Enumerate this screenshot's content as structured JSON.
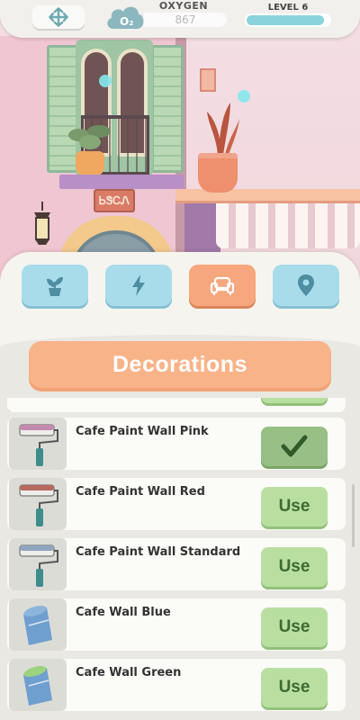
{
  "hud": {
    "oxygen_label": "OXYGEN",
    "oxygen_value": "867",
    "level_label": "LEVEL 6",
    "level_progress": 0.93,
    "o2_badge": "O₂",
    "move_icon": "move-arrows-icon"
  },
  "scene": {
    "sign_text": "ᏏᏕᏟᏁ"
  },
  "tabs": [
    {
      "name": "plants",
      "icon": "potted-plant-icon",
      "active": false
    },
    {
      "name": "energy",
      "icon": "lightning-icon",
      "active": false
    },
    {
      "name": "decorations",
      "icon": "armchair-icon",
      "active": true
    },
    {
      "name": "locations",
      "icon": "map-pin-icon",
      "active": false
    }
  ],
  "panel": {
    "title": "Decorations"
  },
  "items": [
    {
      "name": "Cafe Paint Wall Pink",
      "icon": "paint-roller-pink-icon",
      "button": "✔",
      "selected": true
    },
    {
      "name": "Cafe Paint Wall Red",
      "icon": "paint-roller-red-icon",
      "button": "Use",
      "selected": false
    },
    {
      "name": "Cafe Paint Wall Standard",
      "icon": "paint-roller-standard-icon",
      "button": "Use",
      "selected": false
    },
    {
      "name": "Cafe Wall Blue",
      "icon": "paint-bucket-blue-icon",
      "button": "Use",
      "selected": false
    },
    {
      "name": "Cafe Wall Green",
      "icon": "paint-bucket-green-icon",
      "button": "Use",
      "selected": false
    }
  ],
  "colors": {
    "accent_orange": "#f9b389",
    "tab_blue": "#a9dceb",
    "tab_active": "#f7a77d",
    "use_green": "#b9dfa0",
    "use_text": "#3e6a33"
  }
}
